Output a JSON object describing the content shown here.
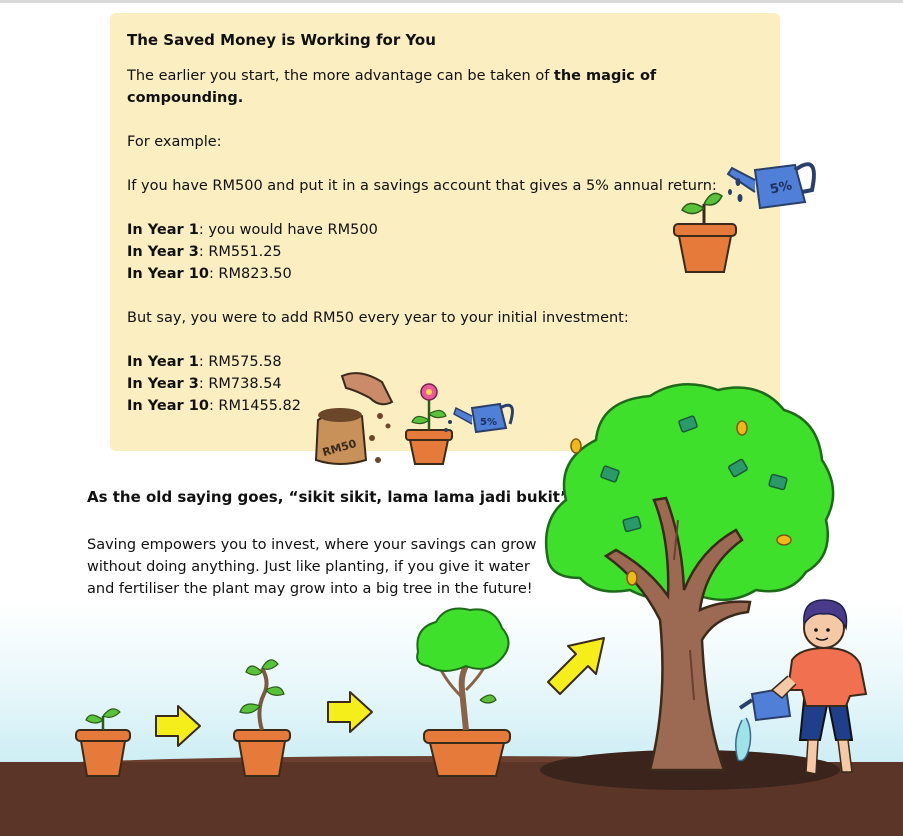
{
  "card": {
    "title": "The Saved Money is Working for You",
    "intro_prefix": "The earlier you start, the more advantage can be taken of ",
    "intro_bold": "the magic of compounding.",
    "example": "For example:",
    "scenario1": "If you have RM500 and put it in a savings account that gives a 5% annual return:",
    "years1": [
      {
        "label": "In Year 1",
        "value": ": you would have RM500"
      },
      {
        "label": "In Year 3",
        "value": ": RM551.25"
      },
      {
        "label": "In Year 10",
        "value": ": RM823.50"
      }
    ],
    "scenario2": "But say, you were to add RM50 every year to your initial investment:",
    "years2": [
      {
        "label": "In Year 1",
        "value": ": RM575.58"
      },
      {
        "label": "In Year 3",
        "value": ": RM738.54"
      },
      {
        "label": "In Year 10",
        "value": ": RM1455.82"
      }
    ]
  },
  "saying": "As the old saying goes, “sikit sikit, lama lama jadi bukit”",
  "paragraph": [
    "Saving empowers you to invest, where your savings can grow",
    "without doing anything. Just like planting, if you give it water",
    "and fertiliser the plant may grow into a big tree in the future!"
  ],
  "illustration": {
    "can_label": "5%",
    "bag_label": "RM50",
    "colors": {
      "card": "#fbefc2",
      "pot": "#e57a3a",
      "leaf": "#58c23a",
      "tree": "#3ee02b",
      "trunk": "#9c6a52",
      "ground": "#5a3528",
      "arrow": "#f5ee1a",
      "can": "#4f7fd6"
    }
  }
}
